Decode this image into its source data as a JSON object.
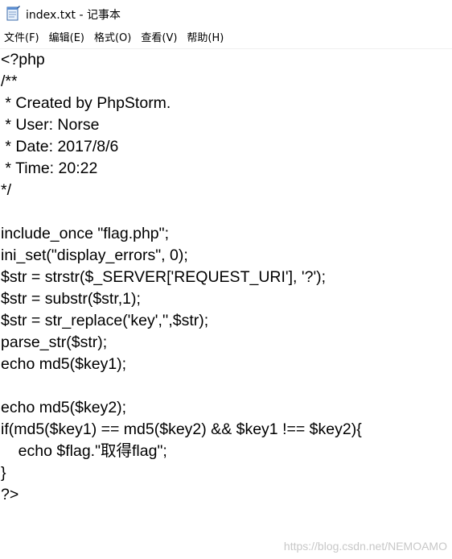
{
  "window": {
    "title": "index.txt - 记事本",
    "icon": "notepad-icon"
  },
  "menu": {
    "items": [
      {
        "label": "文件(F)"
      },
      {
        "label": "编辑(E)"
      },
      {
        "label": "格式(O)"
      },
      {
        "label": "查看(V)"
      },
      {
        "label": "帮助(H)"
      }
    ]
  },
  "editor": {
    "lines": [
      "<?php",
      "/**",
      " * Created by PhpStorm.",
      " * User: Norse",
      " * Date: 2017/8/6",
      " * Time: 20:22",
      "*/",
      "",
      "include_once \"flag.php\";",
      "ini_set(\"display_errors\", 0);",
      "$str = strstr($_SERVER['REQUEST_URI'], '?');",
      "$str = substr($str,1);",
      "$str = str_replace('key','',$str);",
      "parse_str($str);",
      "echo md5($key1);",
      "",
      "echo md5($key2);",
      "if(md5($key1) == md5($key2) && $key1 !== $key2){",
      "    echo $flag.\"取得flag\";",
      "}",
      "?>"
    ]
  },
  "watermark": {
    "text": "https://blog.csdn.net/NEMOAMO"
  }
}
